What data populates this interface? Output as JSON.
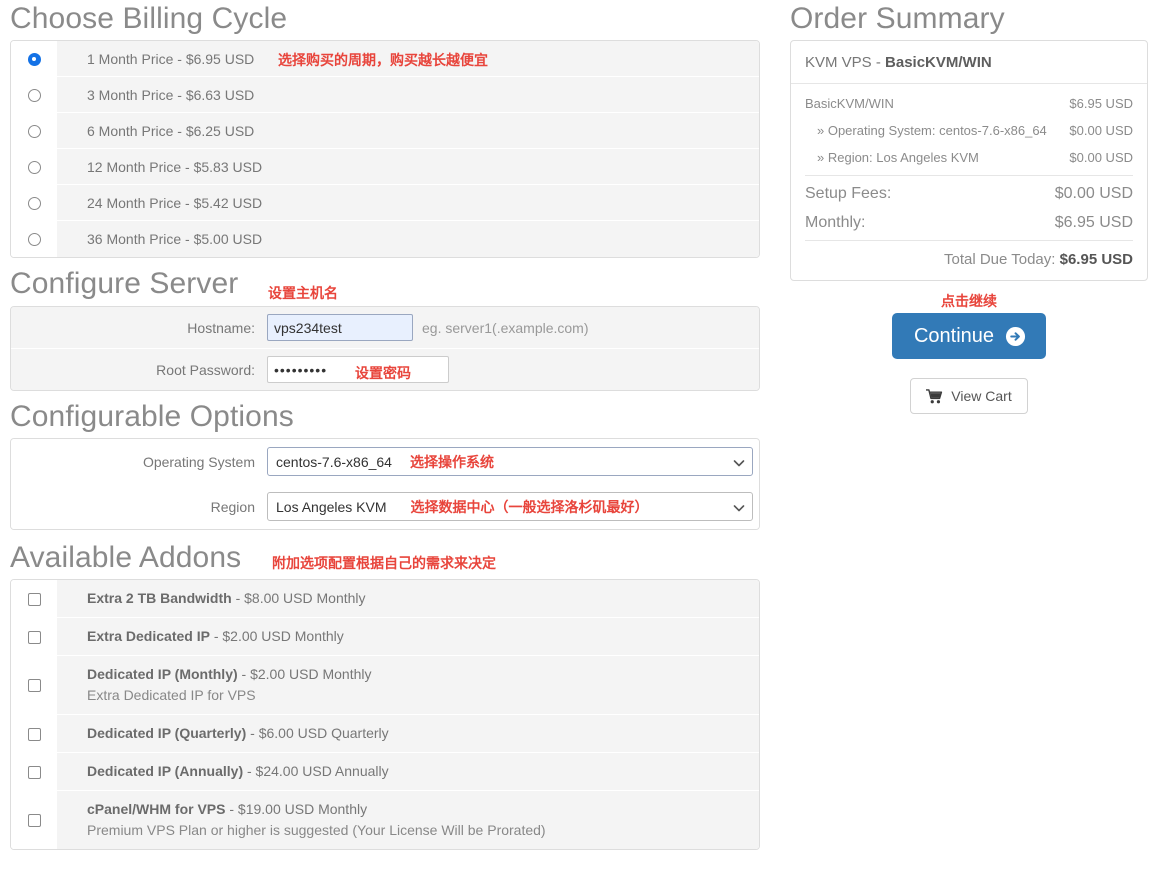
{
  "billing": {
    "heading": "Choose Billing Cycle",
    "annotation": "选择购买的周期，购买越长越便宜",
    "options": [
      {
        "label": "1 Month Price - $6.95 USD",
        "selected": true
      },
      {
        "label": "3 Month Price - $6.63 USD",
        "selected": false
      },
      {
        "label": "6 Month Price - $6.25 USD",
        "selected": false
      },
      {
        "label": "12 Month Price - $5.83 USD",
        "selected": false
      },
      {
        "label": "24 Month Price - $5.42 USD",
        "selected": false
      },
      {
        "label": "36 Month Price - $5.00 USD",
        "selected": false
      }
    ]
  },
  "configure_server": {
    "heading": "Configure Server",
    "annotation_hostname": "设置主机名",
    "annotation_password": "设置密码",
    "hostname_label": "Hostname:",
    "hostname_value": "vps234test",
    "hostname_help": "eg. server1(.example.com)",
    "password_label": "Root Password:",
    "password_value": "•••••••••"
  },
  "configurable_options": {
    "heading": "Configurable Options",
    "os_label": "Operating System",
    "os_value": "centos-7.6-x86_64",
    "os_annotation": "选择操作系统",
    "region_label": "Region",
    "region_value": "Los Angeles KVM",
    "region_annotation": "选择数据中心（一般选择洛杉矶最好）"
  },
  "addons": {
    "heading": "Available Addons",
    "annotation": "附加选项配置根据自己的需求来决定",
    "items": [
      {
        "name": "Extra 2 TB Bandwidth",
        "price": " - $8.00 USD Monthly",
        "desc": "",
        "checked": false
      },
      {
        "name": "Extra Dedicated IP",
        "price": " - $2.00 USD Monthly",
        "desc": "",
        "checked": false
      },
      {
        "name": "Dedicated IP (Monthly)",
        "price": " - $2.00 USD Monthly",
        "desc": "Extra Dedicated IP for VPS",
        "checked": false
      },
      {
        "name": "Dedicated IP (Quarterly)",
        "price": " - $6.00 USD Quarterly",
        "desc": "",
        "checked": false
      },
      {
        "name": "Dedicated IP (Annually)",
        "price": " - $24.00 USD Annually",
        "desc": "",
        "checked": false
      },
      {
        "name": "cPanel/WHM for VPS",
        "price": " - $19.00 USD Monthly",
        "desc": "Premium VPS Plan or higher is suggested (Your License Will be Prorated)",
        "checked": false
      }
    ]
  },
  "summary": {
    "heading": "Order Summary",
    "product_prefix": "KVM VPS - ",
    "product_name": "BasicKVM/WIN",
    "lines": [
      {
        "label": "BasicKVM/WIN",
        "amount": "$6.95 USD",
        "sub": false
      },
      {
        "label": "» Operating System: centos-7.6-x86_64",
        "amount": "$0.00 USD",
        "sub": true
      },
      {
        "label": "» Region: Los Angeles KVM",
        "amount": "$0.00 USD",
        "sub": true
      }
    ],
    "setup_label": "Setup Fees:",
    "setup_amount": "$0.00 USD",
    "monthly_label": "Monthly:",
    "monthly_amount": "$6.95 USD",
    "total_label": "Total Due Today: ",
    "total_amount": "$6.95 USD"
  },
  "actions": {
    "continue_annotation": "点击继续",
    "continue_label": "Continue",
    "view_cart_label": "View Cart"
  },
  "colors": {
    "accent_blue": "#327ab7",
    "radio_blue": "#1472e6",
    "annotation_red": "#e8453c",
    "row_gray": "#f4f4f4",
    "heading_gray": "#8a8a8a",
    "panel_border": "#dddddd"
  }
}
